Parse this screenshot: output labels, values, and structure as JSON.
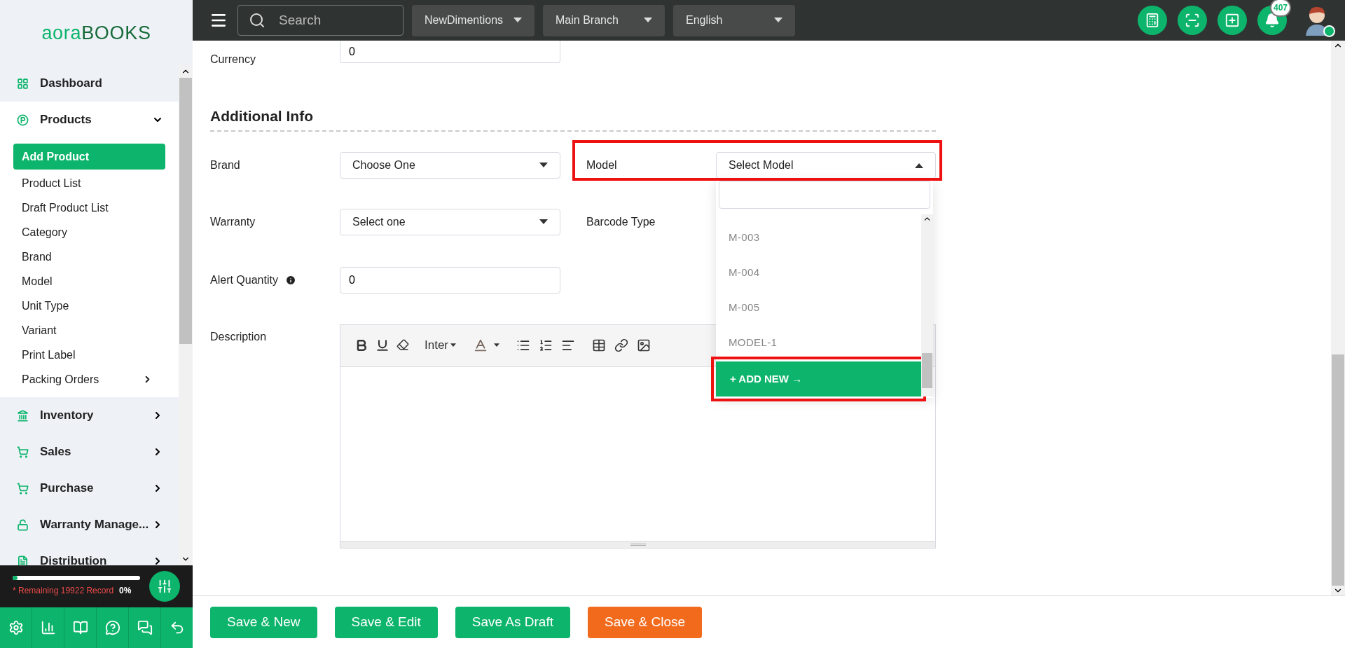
{
  "logo": {
    "first": "aora",
    "second": "BOOKS"
  },
  "sidebar": {
    "items": [
      {
        "label": "Dashboard",
        "expanded": false,
        "selected": false,
        "has_submenu": false
      },
      {
        "label": "Products",
        "expanded": true,
        "selected": false,
        "has_submenu": true,
        "children": [
          {
            "label": "Add Product",
            "selected": true,
            "has_submenu": false
          },
          {
            "label": "Product List",
            "selected": false,
            "has_submenu": false
          },
          {
            "label": "Draft Product List",
            "selected": false,
            "has_submenu": false
          },
          {
            "label": "Category",
            "selected": false,
            "has_submenu": false
          },
          {
            "label": "Brand",
            "selected": false,
            "has_submenu": false
          },
          {
            "label": "Model",
            "selected": false,
            "has_submenu": false
          },
          {
            "label": "Unit Type",
            "selected": false,
            "has_submenu": false
          },
          {
            "label": "Variant",
            "selected": false,
            "has_submenu": false
          },
          {
            "label": "Print Label",
            "selected": false,
            "has_submenu": false
          },
          {
            "label": "Packing Orders",
            "selected": false,
            "has_submenu": true
          }
        ]
      },
      {
        "label": "Inventory",
        "expanded": false,
        "selected": false,
        "has_submenu": true
      },
      {
        "label": "Sales",
        "expanded": false,
        "selected": false,
        "has_submenu": true
      },
      {
        "label": "Purchase",
        "expanded": false,
        "selected": false,
        "has_submenu": true
      },
      {
        "label": "Warranty Manage...",
        "expanded": false,
        "selected": false,
        "has_submenu": true
      },
      {
        "label": "Distribution",
        "expanded": false,
        "selected": false,
        "has_submenu": true
      }
    ]
  },
  "usage": {
    "level": 0.04,
    "note": "* Remaining 19922 Record",
    "percent": "0%"
  },
  "header": {
    "search": {
      "placeholder": "Search"
    },
    "selectors": [
      "NewDimentions",
      "Main Branch",
      "English"
    ],
    "notifications": "407"
  },
  "form": {
    "currency": {
      "label": "Currency",
      "value": "0"
    },
    "section_title": "Additional Info",
    "brand": {
      "label": "Brand",
      "value": "Choose One"
    },
    "model": {
      "label": "Model",
      "placeholder": "Select Model",
      "open": true,
      "highlighted": true,
      "options": [
        "M-003",
        "M-004",
        "M-005",
        "MODEL-1"
      ],
      "add_new": {
        "label": "+ ADD NEW →",
        "highlighted": true
      }
    },
    "warranty": {
      "label": "Warranty",
      "value": "Select one"
    },
    "barcode": {
      "label": "Barcode Type"
    },
    "alert_quantity": {
      "label": "Alert Quantity",
      "value": "0"
    },
    "description": {
      "label": "Description",
      "font": "Inter"
    }
  },
  "buttons": [
    {
      "label": "Save & New",
      "kind": "primary"
    },
    {
      "label": "Save & Edit",
      "kind": "primary"
    },
    {
      "label": "Save As Draft",
      "kind": "primary"
    },
    {
      "label": "Save & Close",
      "kind": "danger"
    }
  ]
}
